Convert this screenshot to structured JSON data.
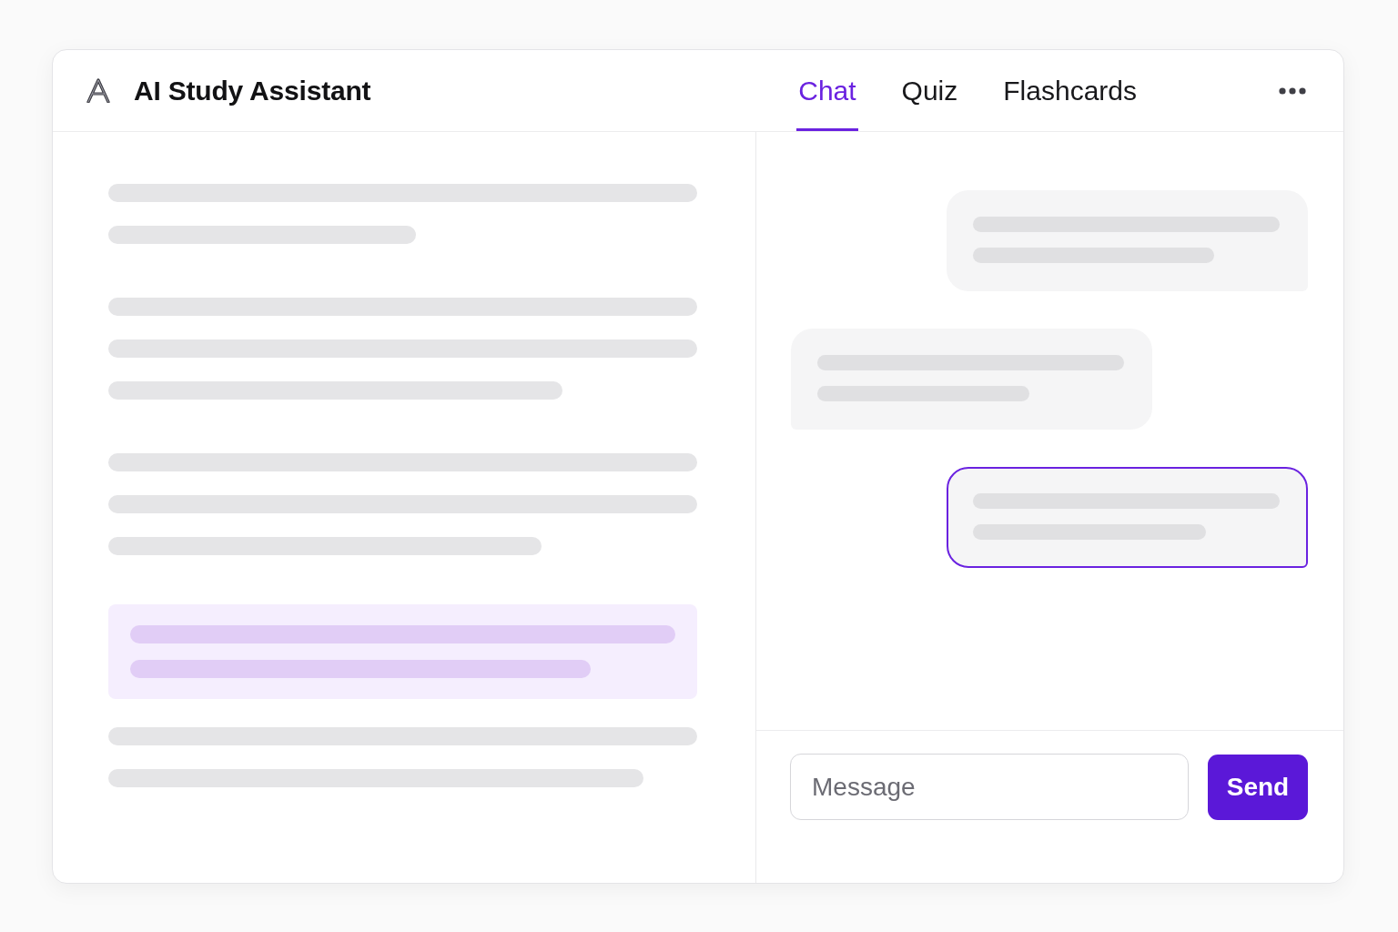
{
  "header": {
    "title": "AI Study Assistant",
    "tabs": [
      {
        "label": "Chat",
        "selected": true
      },
      {
        "label": "Quiz",
        "selected": false
      },
      {
        "label": "Flashcards",
        "selected": false
      }
    ]
  },
  "document": {
    "paragraphs": [
      {
        "highlighted": false
      },
      {
        "highlighted": false
      },
      {
        "highlighted": false
      },
      {
        "highlighted": true
      },
      {
        "highlighted": false
      }
    ]
  },
  "chat": {
    "messages": [
      {
        "kind": "outgoing",
        "selected": false
      },
      {
        "kind": "incoming",
        "selected": false
      },
      {
        "kind": "outgoing",
        "selected": true
      }
    ],
    "composer": {
      "placeholder": "Message",
      "send_button": "Send"
    }
  }
}
